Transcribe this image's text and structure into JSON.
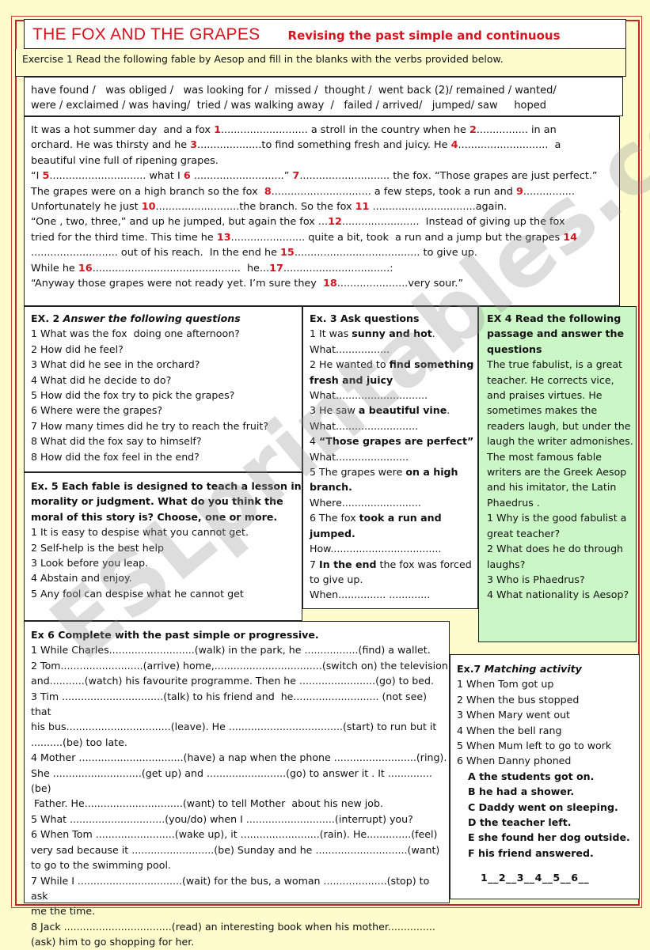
{
  "header": {
    "title": "THE FOX AND THE GRAPES",
    "subtitle": "Revising the past simple and continuous"
  },
  "exercise1": {
    "instruction": "Exercise 1  Read the following fable by Aesop and fill in the blanks with the verbs provided below.",
    "verbs_line1": "have found /   was obliged /   was looking for /  missed /  thought /  went back (2)/ remained / wanted/",
    "verbs_line2": "were / exclaimed / was having/  tried / was walking away  /   failed / arrived/   jumped/ saw     hoped",
    "story": [
      [
        "It was a hot summer day  and a fox ",
        "1",
        "........................... a stroll in the country when he ",
        "2",
        "................ in an"
      ],
      [
        "orchard. He was thirsty and he ",
        "3",
        "....................to find something fresh and juicy. He ",
        "4",
        "............................  a"
      ],
      [
        "beautiful vine full of ripening grapes."
      ],
      [
        "“I ",
        "5",
        ".............................. what I ",
        "6",
        " ............................” ",
        "7",
        "............................ the fox. “Those grapes are just perfect.”"
      ],
      [
        "The grapes were on a high branch so the fox  ",
        "8",
        "............................... a few steps, took a run and ",
        "9",
        "................"
      ],
      [
        "Unfortunately he just ",
        "10",
        "..........................the branch. So the fox ",
        "11",
        " ................................again."
      ],
      [
        "“One , two, three,” and up he jumped, but again the fox ...",
        "12",
        "........................  Instead of giving up the fox"
      ],
      [
        "tried for the third time. This time he ",
        "13",
        "....................... quite a bit, took  a run and a jump but the grapes ",
        "14"
      ],
      [
        "........................... out of his reach.  In the end he ",
        "15",
        "....................................... to give up."
      ],
      [
        "While he ",
        "16",
        "..............................................  he...",
        "17",
        ".................................:"
      ],
      [
        "“Anyway those grapes were not ready yet. I’m sure they  ",
        "18",
        "......................very sour.”"
      ]
    ]
  },
  "exercise2": {
    "title_num": "EX. 2 ",
    "title": "Answer the following questions",
    "questions": [
      "1 What was the fox  doing one afternoon?",
      "2 How did he feel?",
      "3 What did he see in the orchard?",
      "4 What did he decide to do?",
      "5 How did the fox try to pick the grapes?",
      "6 Where were the grapes?",
      "7 How many times did he try to reach the fruit?",
      "8 What did the fox say to himself?",
      "8 How did the fox feel in the end?"
    ]
  },
  "exercise3": {
    "title": "Ex. 3 Ask questions",
    "items": [
      {
        "pre": "1 It was ",
        "bold": "sunny  and hot",
        "post": ".",
        "prompt": "What................."
      },
      {
        "pre": "2 He wanted to ",
        "bold": "find something fresh and juicy",
        "post": "",
        "prompt": "What............................."
      },
      {
        "pre": "3 He saw ",
        "bold": "a beautiful vine",
        "post": ".",
        "prompt": "What.........................."
      },
      {
        "pre": "4 ",
        "bold": "“Those grapes are perfect”",
        "post": "",
        "prompt": "What......................."
      },
      {
        "pre": "5 The grapes were ",
        "bold": "on a high branch.",
        "post": "",
        "prompt": "Where........................."
      },
      {
        "pre": "6 The fox ",
        "bold": "took a run and jumped.",
        "post": "",
        "prompt": "How..................................."
      },
      {
        "pre": "7 ",
        "bold": "In the end",
        "post": " the fox was forced to give up.",
        "prompt": "When............... ............."
      }
    ]
  },
  "exercise4": {
    "title": "EX 4 Read the following passage and answer the questions",
    "passage": "The true fabulist, is a great teacher. He corrects vice, and praises virtues. He sometimes makes the readers  laugh, but under the laugh the  writer admonishes.  The most famous fable writers are the Greek Aesop and his imitator, the Latin Phaedrus .",
    "questions": [
      "1 Why is the good fabulist a great teacher?",
      "2 What does he do through laughs?",
      "3 Who is Phaedrus?",
      "4 What nationality is Aesop?"
    ]
  },
  "exercise5": {
    "title": "Ex. 5 Each  fable is designed to teach a lesson in morality or judgment. What do you think the moral of this story is? Choose, one or more.",
    "options": [
      "1 It is easy to despise what you cannot get.",
      "2 Self-help is the best help",
      "3 Look before you leap.",
      "4 Abstain and enjoy.",
      "5 Any fool can despise what he cannot get"
    ]
  },
  "exercise6": {
    "title": "Ex 6 Complete with the  past simple or progressive.",
    "lines": [
      "1 While Charles...........................(walk) in the park, he .................(find) a wallet.",
      "2 Tom..........................(arrive) home,..................................(switch on) the television",
      "and...........(watch) his favourite programme. Then he ........................(go) to bed.",
      "3 Tim ................................(talk) to his friend and  he........................... (not see) that",
      "his bus.................................(leave). He ....................................(start) to run but it",
      "..........(be) too late.",
      "4 Mother .................................(have) a nap when the phone ..........................(ring).",
      "She ............................(get up) and .........................(go) to answer it . It ..............(be)",
      " Father. He...............................(want) to tell Mother  about his new job.",
      "5 What ..............................(you/do) when I ............................(interrupt) you?",
      "6 When Tom .........................(wake up), it .........................(rain). He..............(feel)",
      "very sad because it ..........................(be) Sunday and he .............................(want)",
      "to go to the swimming pool.",
      "7 While I .................................(wait) for the bus, a woman ....................(stop) to ask",
      "me the time.",
      "8 Jack ..................................(read) an interesting book when his mother...............",
      "(ask) him to go shopping for her."
    ]
  },
  "exercise7": {
    "title_num": "Ex.7 ",
    "title": " Matching activity",
    "left": [
      "1 When Tom got up",
      "2 When the bus stopped",
      "3 When Mary went out",
      "4 When the bell rang",
      "5 When Mum left to go to work",
      "6 When Danny phoned"
    ],
    "right": [
      "A the students got on.",
      "B he had a shower.",
      "C Daddy went on sleeping.",
      "D the teacher left.",
      "E she found her dog outside.",
      "F his friend answered."
    ],
    "answer_line": "1__2__3__4__5__6__"
  },
  "watermark": "ESLprintables.com",
  "colors": {
    "accent_red": "#d4151f",
    "page_bg": "#fdfccd",
    "ex4_bg": "#cbf7c6"
  }
}
